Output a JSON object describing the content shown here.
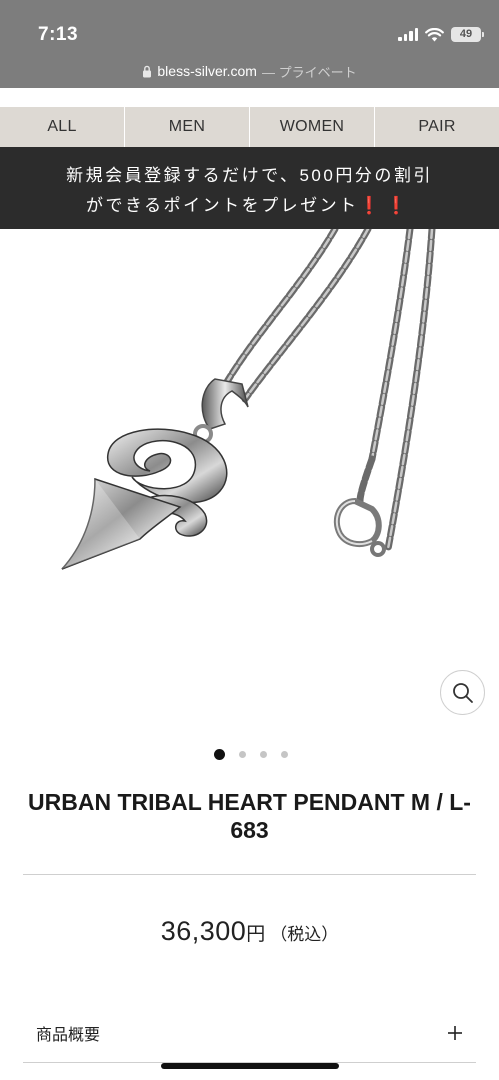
{
  "status_bar": {
    "time": "7:13",
    "battery": "49",
    "icons": [
      "signal-icon",
      "wifi-icon",
      "battery-icon"
    ]
  },
  "browser": {
    "url": "bless-silver.com",
    "mode_label": "— プライベート",
    "icon": "lock-icon"
  },
  "category_nav": {
    "tabs": [
      {
        "label": "ALL"
      },
      {
        "label": "MEN"
      },
      {
        "label": "WOMEN"
      },
      {
        "label": "PAIR"
      }
    ]
  },
  "promo": {
    "line1": "新規会員登録するだけで、500円分の割引",
    "line2": "ができるポイントをプレゼント",
    "marks": "❗❗",
    "marks_color": "#e2262d"
  },
  "product": {
    "image_icon": "pendant-necklace-image",
    "zoom_icon": "magnifier-icon",
    "carousel": {
      "count": 4,
      "active_index": 0
    },
    "title": "URBAN TRIBAL HEART PENDANT M / L-683",
    "price": "36,300",
    "price_unit": "円",
    "tax_label": "（税込）"
  },
  "accordion": {
    "label": "商品概要",
    "icon": "plus-icon"
  },
  "colors": {
    "status_bar_bg": "#7d7d7d",
    "nav_bg": "#ddd9d3",
    "banner_bg": "#2c2c2c",
    "accent_red": "#e2262d"
  }
}
